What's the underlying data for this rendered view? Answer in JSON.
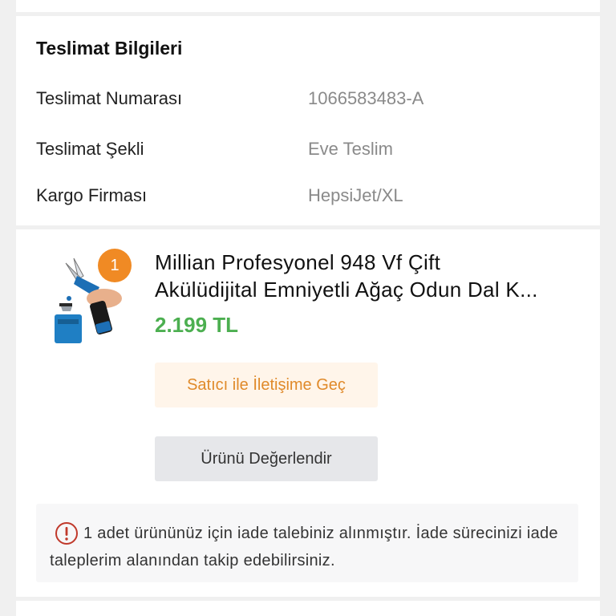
{
  "delivery": {
    "title": "Teslimat Bilgileri",
    "rows": [
      {
        "label": "Teslimat Numarası",
        "value": "1066583483-A"
      },
      {
        "label": "Teslimat Şekli",
        "value": "Eve Teslim"
      },
      {
        "label": "Kargo Firması",
        "value": "HepsiJet/XL"
      }
    ]
  },
  "product": {
    "quantity": "1",
    "name_line1": "Millian Profesyonel 948 Vf Çift",
    "name_line2": "Akülüdijital Emniyetli Ağaç Odun Dal K...",
    "price": "2.199 TL",
    "contact_button": "Satıcı ile İletişime Geç",
    "review_button": "Ürünü Değerlendir",
    "image_icon": "pruning-shears-product-image"
  },
  "notice": {
    "icon": "exclamation-circle-icon",
    "text": "1 adet ürününüz için iade talebiniz alınmıştır. İade sürecinizi iade taleplerim alanından takip edebilirsiniz."
  },
  "colors": {
    "price": "#4caf50",
    "badge": "#f08a24",
    "contact_text": "#e08a2a",
    "notice_icon": "#c0392b"
  }
}
